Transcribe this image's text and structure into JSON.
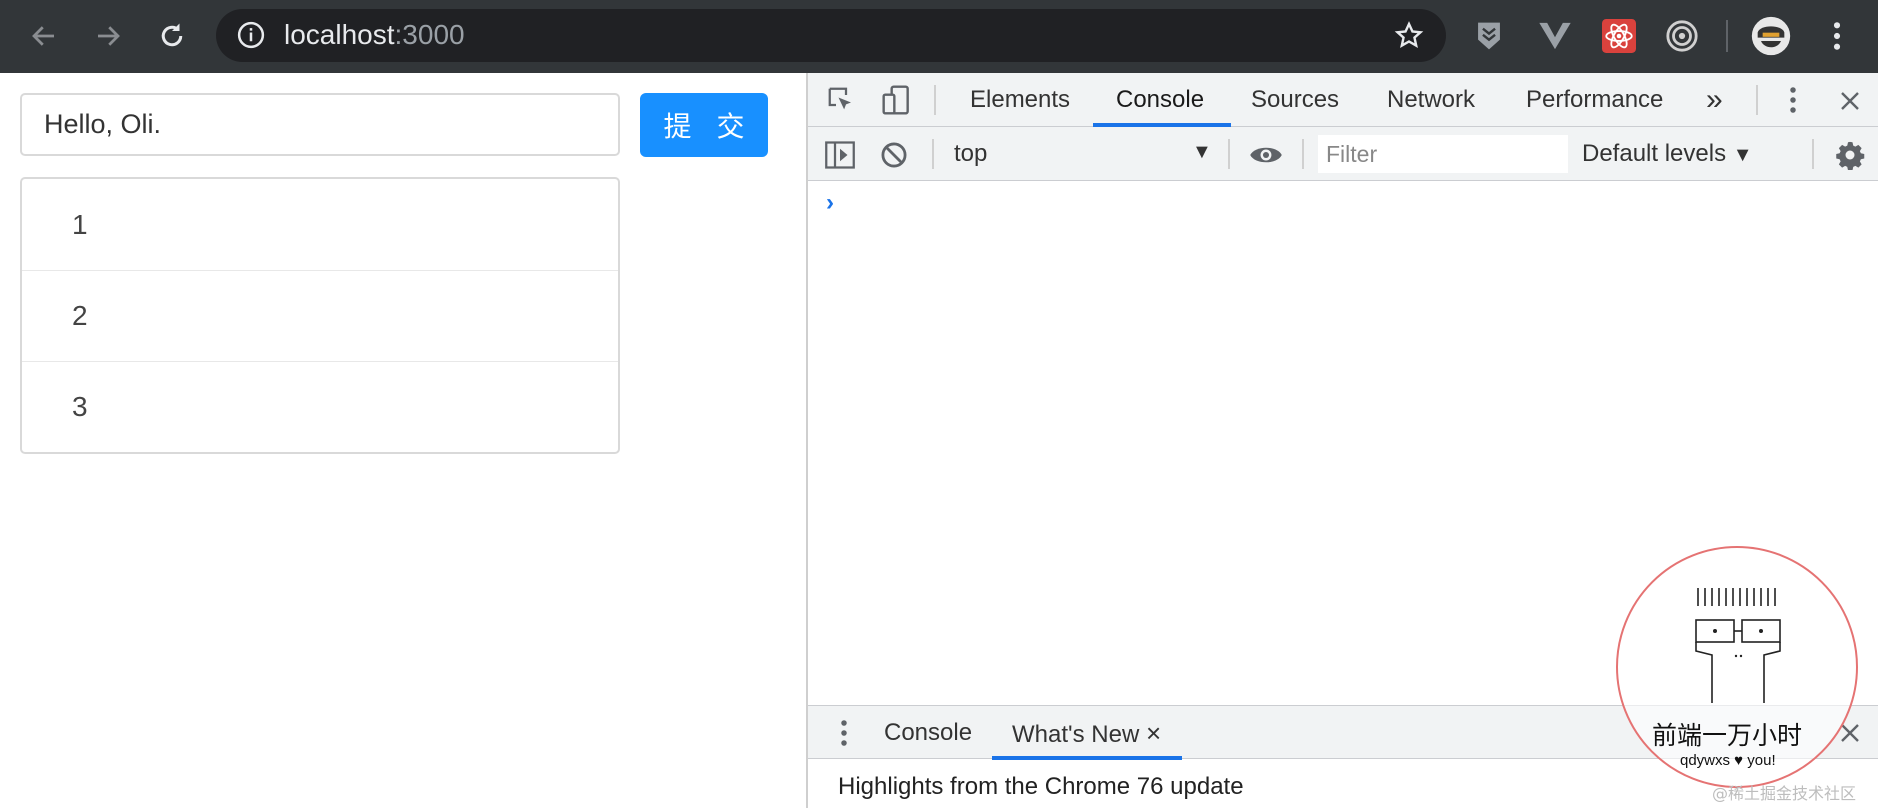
{
  "browser": {
    "url_host": "localhost",
    "url_port": ":3000",
    "icons": [
      "back-icon",
      "forward-icon",
      "reload-icon",
      "info-icon",
      "star-icon",
      "extension-shield-icon",
      "vue-devtools-icon",
      "react-devtools-icon",
      "target-icon",
      "profile-avatar",
      "menu-kebab-icon"
    ]
  },
  "page": {
    "input_value": "Hello, Oli.",
    "submit_label": "提 交",
    "list_items": [
      "1",
      "2",
      "3"
    ]
  },
  "devtools": {
    "tabs": [
      "Elements",
      "Console",
      "Sources",
      "Network",
      "Performance"
    ],
    "active_tab": "Console",
    "more_tabs": "»",
    "context": "top",
    "filter_placeholder": "Filter",
    "levels": "Default levels",
    "prompt": "›",
    "drawer": {
      "tabs": [
        "Console",
        "What's New"
      ],
      "active_tab": "What's New",
      "close": "×",
      "highlight": "Highlights from the Chrome 76 update"
    },
    "accent": "#1a73e8"
  },
  "watermark": {
    "title": "前端一万小时",
    "subtitle": "qdywxs ♥ you!",
    "corner": "@稀土掘金技术社区"
  },
  "colors": {
    "browser_bar": "#323639",
    "omnibox": "#202124",
    "primary_button": "#1890ff",
    "stamp_border": "#e57373"
  }
}
